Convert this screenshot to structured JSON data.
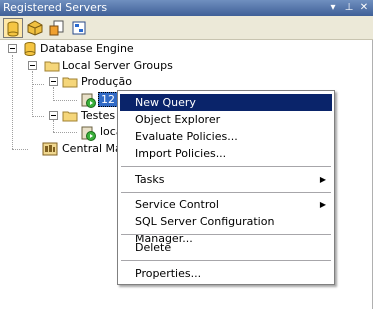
{
  "window": {
    "title": "Registered Servers",
    "pin_glyph": "▾",
    "autohide_glyph": "⊥",
    "close_glyph": "✕"
  },
  "toolbar": {
    "icons": [
      "database-engine-icon",
      "analysis-services-icon",
      "reporting-services-icon",
      "integration-services-icon"
    ]
  },
  "tree": {
    "root": "Database Engine",
    "local_groups": "Local Server Groups",
    "producao": "Produção",
    "producao_server": "12",
    "testes": "Testes",
    "testes_server": "loca",
    "central": "Central Ma"
  },
  "context_menu": {
    "new_query": "New Query",
    "object_explorer": "Object Explorer",
    "evaluate_policies": "Evaluate Policies...",
    "import_policies": "Import Policies...",
    "tasks": "Tasks",
    "service_control": "Service Control",
    "config_manager": "SQL Server Configuration Manager...",
    "delete": "Delete",
    "properties": "Properties...",
    "submenu_arrow": "▶"
  },
  "colors": {
    "menu_highlight": "#0a246a",
    "selection": "#316ac5",
    "titlebar": "#4f6fa7"
  }
}
